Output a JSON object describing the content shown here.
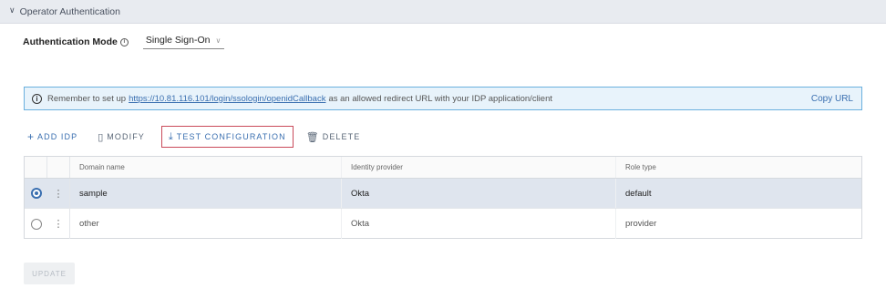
{
  "section": {
    "title": "Operator Authentication"
  },
  "auth": {
    "label": "Authentication Mode",
    "info_glyph": "i",
    "selected_mode": "Single Sign-On"
  },
  "banner": {
    "prefix": "Remember to set up",
    "link": "https://10.81.116.101/login/ssologin/openidCallback",
    "suffix": "as an allowed redirect URL with your IDP application/client",
    "copy_label": "Copy URL"
  },
  "toolbar": {
    "add_label": "ADD IDP",
    "modify_label": "MODIFY",
    "test_label": "TEST CONFIGURATION",
    "delete_label": "DELETE"
  },
  "table": {
    "columns": [
      "Domain name",
      "Identity provider",
      "Role type"
    ],
    "rows": [
      {
        "domain": "sample",
        "provider": "Okta",
        "role": "default",
        "selected": true
      },
      {
        "domain": "other",
        "provider": "Okta",
        "role": "provider",
        "selected": false
      }
    ]
  },
  "update_label": "UPDATE",
  "colors": {
    "accent": "#3a6fb0",
    "highlight_border": "#c94a5a",
    "banner_bg": "#e8f3fb",
    "selected_row": "#dfe5ee"
  }
}
